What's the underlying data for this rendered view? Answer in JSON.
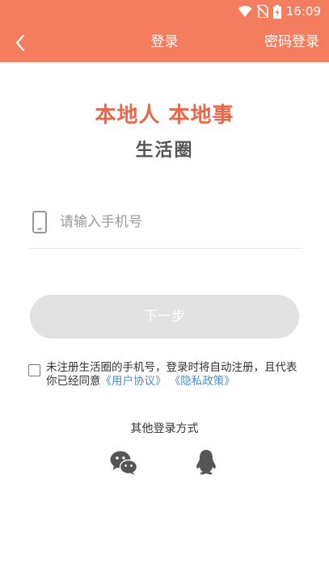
{
  "status_bar": {
    "time": "16:09",
    "icons": [
      "wifi-icon",
      "no-sim-icon",
      "battery-charging-icon"
    ]
  },
  "header": {
    "back_icon": "chevron-left-icon",
    "title": "登录",
    "right_action": "密码登录",
    "background_color": "#f57d5f"
  },
  "main": {
    "slogan": "本地人 本地事",
    "subtitle": "生活圈",
    "phone_input": {
      "placeholder": "请输入手机号",
      "value": "",
      "icon": "phone-icon"
    },
    "next_button": "下一步",
    "agreement": {
      "checked": false,
      "text": "未注册生活圈的手机号，登录时将自动注册，且代表你已经同意",
      "user_agreement": "《用户协议》",
      "privacy_policy": "《隐私政策》"
    },
    "other_login": {
      "title": "其他登录方式",
      "methods": [
        "wechat-icon",
        "qq-icon"
      ]
    }
  },
  "colors": {
    "accent": "#f57d5f",
    "slogan": "#e8674a",
    "link": "#4d8ec7",
    "button_disabled": "#e2e2e2"
  }
}
